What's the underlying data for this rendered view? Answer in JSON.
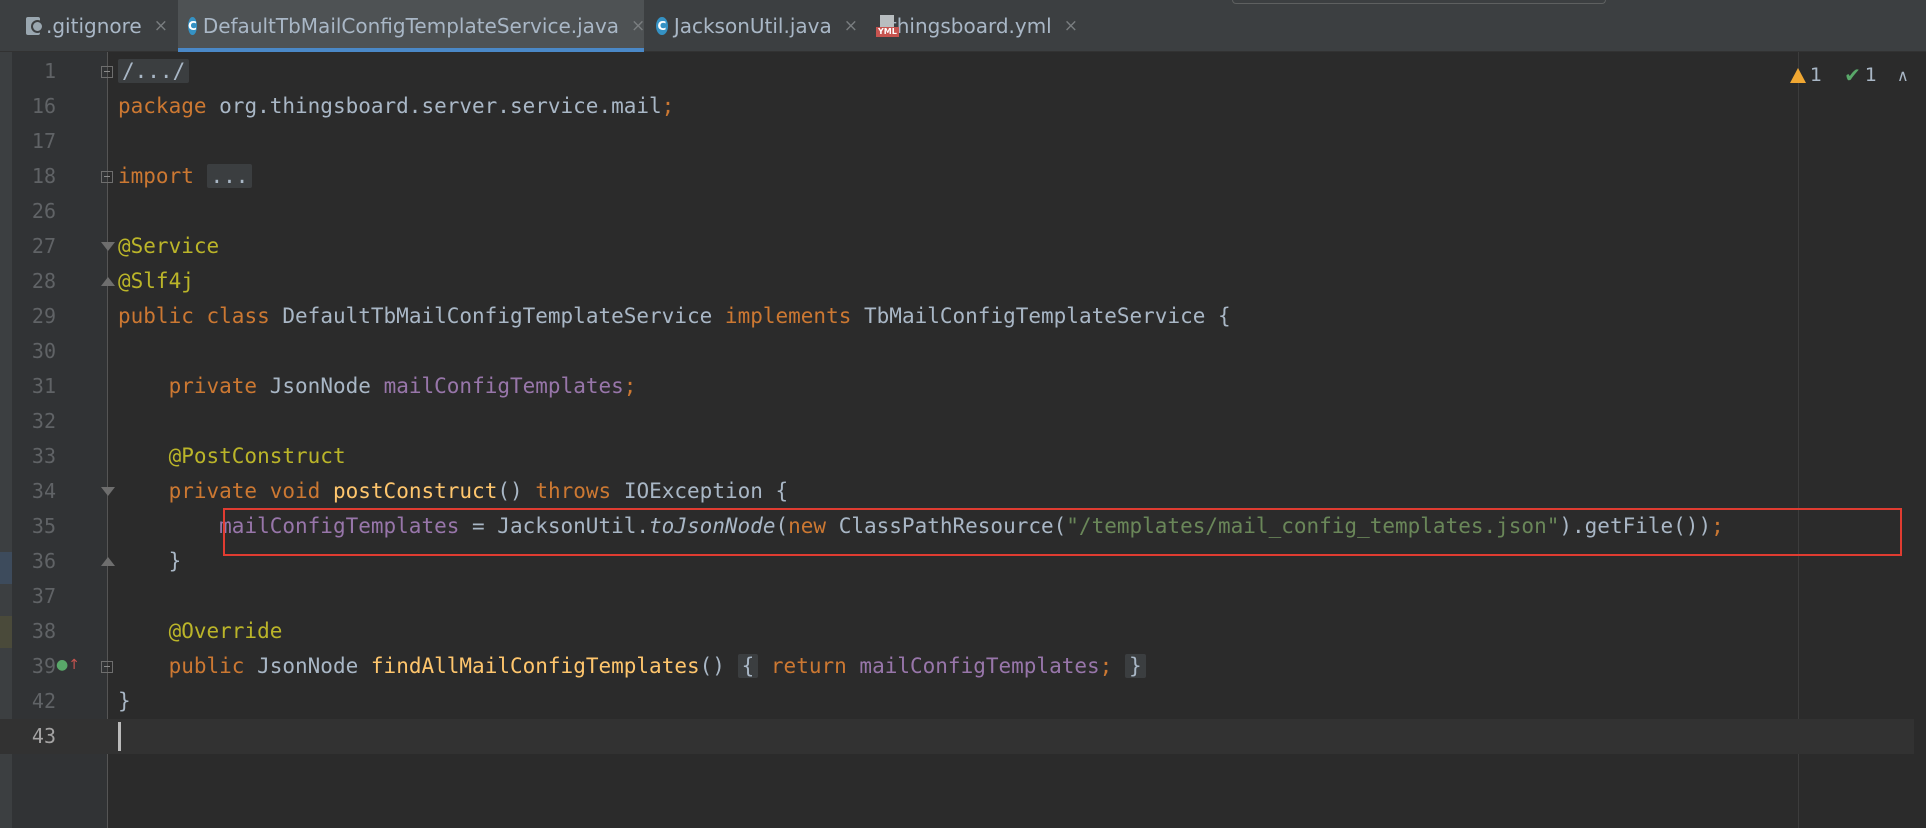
{
  "tabs": [
    {
      "label": ".gitignore",
      "icon": "ignore-file-icon",
      "active": false
    },
    {
      "label": "DefaultTbMailConfigTemplateService.java",
      "icon": "java-class-icon",
      "active": true
    },
    {
      "label": "JacksonUtil.java",
      "icon": "java-class-icon",
      "active": false
    },
    {
      "label": "thingsboard.yml",
      "icon": "yaml-file-icon",
      "active": false
    }
  ],
  "tab_close_glyph": "×",
  "class_icon_letter": "C",
  "yml_icon_text": "YML",
  "inspections": {
    "warnings": "1",
    "ok": "1"
  },
  "editor": {
    "line_numbers": [
      "1",
      "16",
      "17",
      "18",
      "26",
      "27",
      "28",
      "29",
      "30",
      "31",
      "32",
      "33",
      "34",
      "35",
      "36",
      "37",
      "38",
      "39",
      "42",
      "43"
    ],
    "current_line": "43",
    "text": {
      "l1_fold": "/.../",
      "l16_package_kw": "package",
      "l16_package_name": " org.thingsboard.server.service.mail",
      "l16_semicolon": ";",
      "l18_import_kw": "import",
      "l18_fold": "...",
      "l27_annotation": "@Service",
      "l28_annotation": "@Slf4j",
      "l29_public": "public",
      "l29_class": "class",
      "l29_name": "DefaultTbMailConfigTemplateService",
      "l29_implements": "implements",
      "l29_iface": "TbMailConfigTemplateService {",
      "l31_private": "private",
      "l31_type": "JsonNode",
      "l31_field": "mailConfigTemplates",
      "l31_semicolon": ";",
      "l33_annotation": "@PostConstruct",
      "l34_private": "private",
      "l34_void": "void",
      "l34_method": "postConstruct",
      "l34_parens": "()",
      "l34_throws": "throws",
      "l34_exception": "IOException {",
      "l35_field": "mailConfigTemplates",
      "l35_assign": " = JacksonUtil.",
      "l35_call": "toJsonNode",
      "l35_open": "(",
      "l35_new": "new",
      "l35_class": " ClassPathResource(",
      "l35_string": "\"/templates/mail_config_templates.json\"",
      "l35_tail": ").getFile())",
      "l35_semicolon": ";",
      "l36_brace": "}",
      "l38_annotation": "@Override",
      "l39_public": "public",
      "l39_type": "JsonNode",
      "l39_method": "findAllMailConfigTemplates",
      "l39_parens": "()",
      "l39_open": "{",
      "l39_return": "return",
      "l39_field": "mailConfigTemplates",
      "l39_semicolon": ";",
      "l39_close": "}",
      "l42_brace": "}"
    }
  },
  "colors": {
    "keyword": "#cc7832",
    "annotation": "#bbb529",
    "field": "#9876aa",
    "string": "#6a8759",
    "method": "#ffc66d",
    "highlight_box": "#e03c31"
  }
}
